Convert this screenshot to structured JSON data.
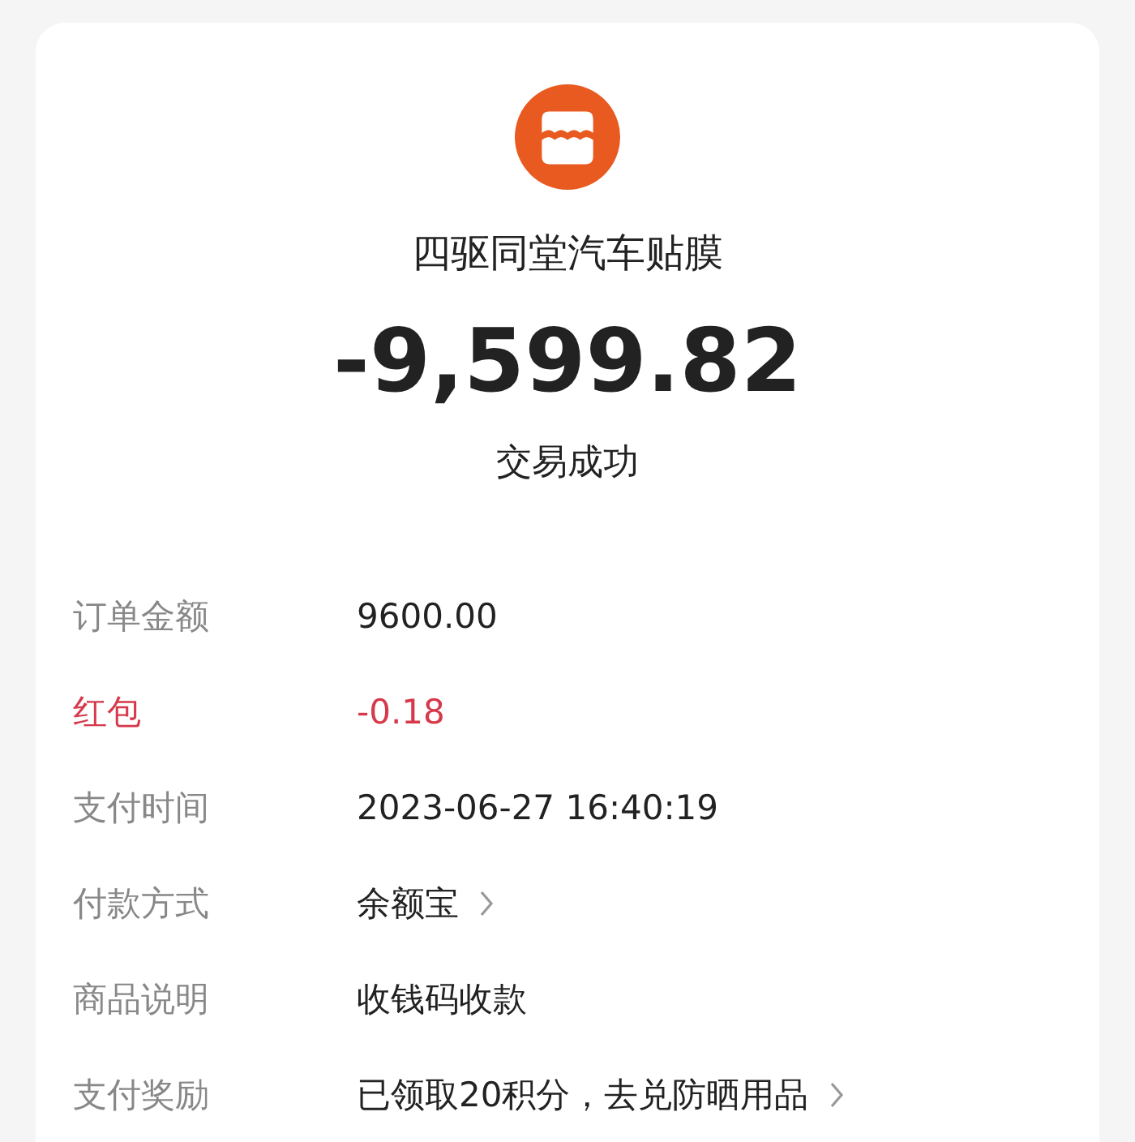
{
  "merchant": {
    "name": "四驱同堂汽车贴膜"
  },
  "amount": "-9,599.82",
  "status": "交易成功",
  "details": [
    {
      "label": "订单金额",
      "value": "9600.00",
      "highlight": false,
      "link": false
    },
    {
      "label": "红包",
      "value": "-0.18",
      "highlight": true,
      "link": false
    },
    {
      "label": "支付时间",
      "value": "2023-06-27 16:40:19",
      "highlight": false,
      "link": false
    },
    {
      "label": "付款方式",
      "value": "余额宝",
      "highlight": false,
      "link": true
    },
    {
      "label": "商品说明",
      "value": "收钱码收款",
      "highlight": false,
      "link": false
    },
    {
      "label": "支付奖励",
      "value": "已领取20积分，去兑防晒用品",
      "highlight": false,
      "link": true
    }
  ]
}
